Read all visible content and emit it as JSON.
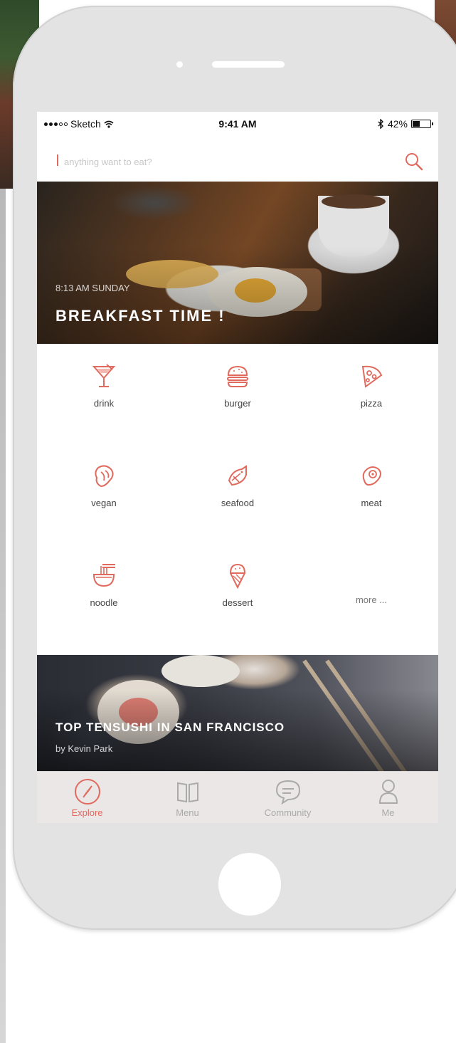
{
  "status_bar": {
    "carrier": "Sketch",
    "time": "9:41 AM",
    "battery_percent": "42%",
    "battery_level": 0.42
  },
  "search": {
    "placeholder": "anything want to eat?"
  },
  "hero": {
    "time_text": "8:13 AM SUNDAY",
    "title": "BREAKFAST TIME !"
  },
  "categories": [
    {
      "label": "drink",
      "icon": "cocktail-icon"
    },
    {
      "label": "burger",
      "icon": "burger-icon"
    },
    {
      "label": "pizza",
      "icon": "pizza-icon"
    },
    {
      "label": "vegan",
      "icon": "vegan-icon"
    },
    {
      "label": "seafood",
      "icon": "fish-icon"
    },
    {
      "label": "meat",
      "icon": "meat-icon"
    },
    {
      "label": "noodle",
      "icon": "noodle-bowl-icon"
    },
    {
      "label": "dessert",
      "icon": "ice-cream-icon"
    },
    {
      "label": "more ...",
      "icon": ""
    }
  ],
  "featured": {
    "title": "TOP TENSUSHI IN SAN FRANCISCO",
    "author": "by Kevin Park"
  },
  "tabs": [
    {
      "label": "Explore",
      "icon": "compass-icon",
      "active": true
    },
    {
      "label": "Menu",
      "icon": "book-icon",
      "active": false
    },
    {
      "label": "Community",
      "icon": "chat-bubble-icon",
      "active": false
    },
    {
      "label": "Me",
      "icon": "user-icon",
      "active": false
    }
  ],
  "colors": {
    "accent": "#e06a5e",
    "tab_inactive": "#aaaaaa",
    "phone_body": "#e3e3e3"
  }
}
